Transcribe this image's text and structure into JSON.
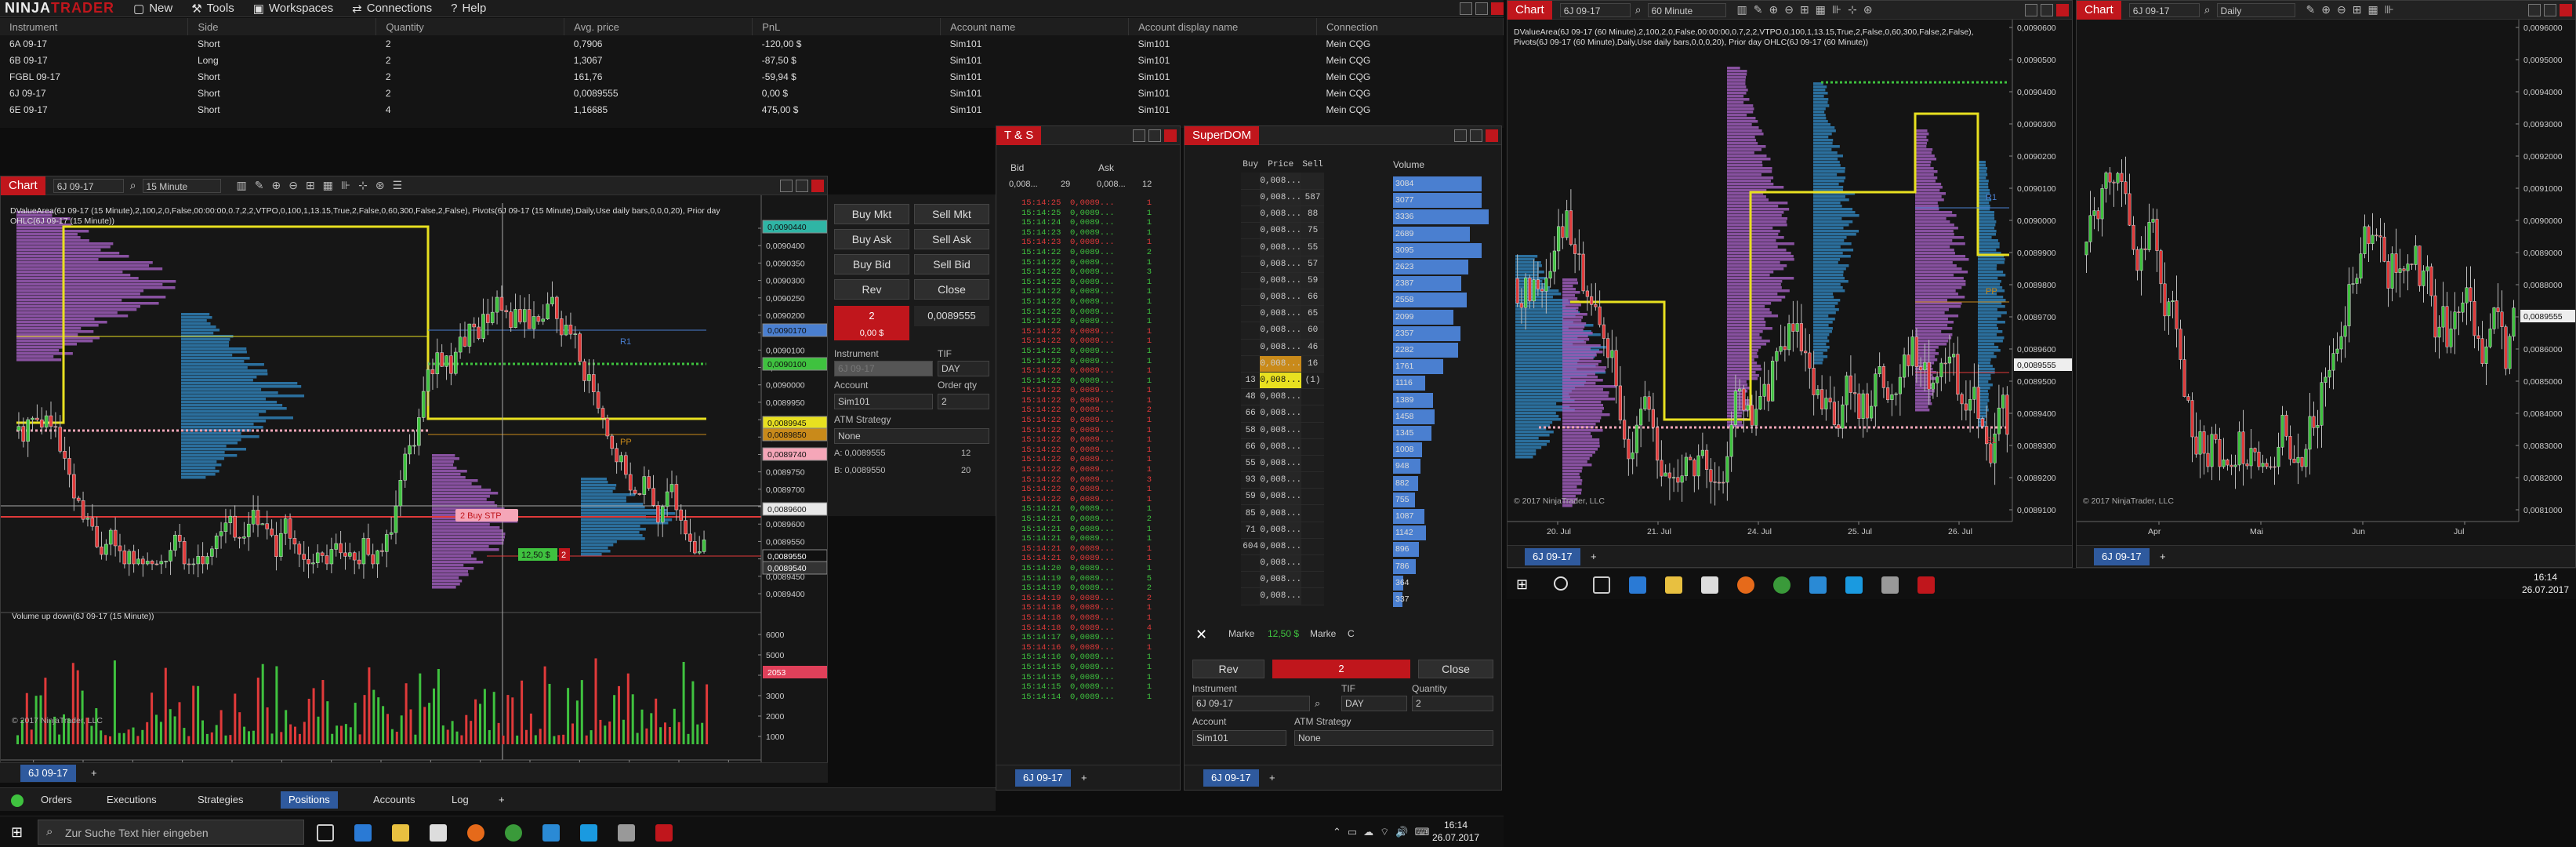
{
  "app": {
    "logo": "NINJATRADER",
    "menu": [
      "New",
      "Tools",
      "Workspaces",
      "Connections",
      "Help"
    ]
  },
  "positions": {
    "headers": [
      "Instrument",
      "Side",
      "Quantity",
      "Avg. price",
      "PnL",
      "Account name",
      "Account display name",
      "Connection"
    ],
    "rows": [
      [
        "6A 09-17",
        "Short",
        "2",
        "0,7906",
        "-120,00 $",
        "Sim101",
        "Sim101",
        "Mein CQG"
      ],
      [
        "6B 09-17",
        "Long",
        "2",
        "1,3067",
        "-87,50 $",
        "Sim101",
        "Sim101",
        "Mein CQG"
      ],
      [
        "FGBL 09-17",
        "Short",
        "2",
        "161,76",
        "-59,94 $",
        "Sim101",
        "Sim101",
        "Mein CQG"
      ],
      [
        "6J 09-17",
        "Short",
        "2",
        "0,0089555",
        "0,00 $",
        "Sim101",
        "Sim101",
        "Mein CQG"
      ],
      [
        "6E 09-17",
        "Short",
        "4",
        "1,16685",
        "475,00 $",
        "Sim101",
        "Sim101",
        "Mein CQG"
      ]
    ],
    "tabs": [
      "Orders",
      "Executions",
      "Strategies",
      "Positions",
      "Accounts",
      "Log"
    ],
    "active_tab": "Positions"
  },
  "chart1": {
    "title": "Chart",
    "instrument": "6J 09-17",
    "interval": "15 Minute",
    "indicator_text": "DValueArea(6J 09-17 (15 Minute),2,100,2,0,False,00:00:00,0.7,2,2,VTPO,0,100,1,13.15,True,2,False,0,60,300,False,2,False), Pivots(6J 09-17 (15 Minute),Daily,Use daily bars,0,0,0,20), Prior day OHLC(6J 09-17 (15 Minute))",
    "copyright": "© 2017 NinjaTrader, LLC",
    "volume_label": "Volume up down(6J 09-17 (15 Minute))",
    "price_ticks": [
      "0,0090450",
      "0,0090400",
      "0,0090350",
      "0,0090300",
      "0,0090250",
      "0,0090200",
      "0,0090150",
      "0,0090100",
      "0,0090050",
      "0,0090000",
      "0,0089950",
      "0,0089900",
      "0,0089850",
      "0,0089800",
      "0,0089750",
      "0,0089700",
      "0,0089650",
      "0,0089600",
      "0,0089550",
      "0,0089500",
      "0,0089450",
      "0,0089400"
    ],
    "price_flags": [
      {
        "text": "0,0090440",
        "color": "#2fb5a5"
      },
      {
        "text": "0,0090170",
        "color": "#4a7fd0"
      },
      {
        "text": "0,0090100",
        "color": "#3fc23f"
      },
      {
        "text": "0,0089945",
        "color": "#e8e020"
      },
      {
        "text": "0,0089850",
        "color": "#c98a1a"
      },
      {
        "text": "0,0089740",
        "color": "#f5a6b8"
      },
      {
        "text": "0,0089600",
        "color": "#e8e8e8"
      },
      {
        "text": "0,0089550",
        "color": "#111111"
      },
      {
        "text": "0,0089540",
        "color": "#333333"
      }
    ],
    "volume_ticks": [
      "6000",
      "5000",
      "4000",
      "3000",
      "2000",
      "1000"
    ],
    "volume_flag": "2053",
    "time_ticks": [
      "19:00",
      "25. Jul",
      "03:15",
      "06:00",
      "09:00",
      "11:45",
      "14:45",
      "17:45",
      "26. Jul",
      "03:15",
      "06:00",
      "09:00",
      "12:00",
      "14:45",
      "17:45"
    ],
    "order_label": "2  Buy STP",
    "position_label": "12,50 $",
    "position_qty": "2",
    "pivot_labels": [
      "R1",
      "PP"
    ],
    "tab": "6J 09-17"
  },
  "chart_trader": {
    "buttons": [
      "Buy Mkt",
      "Sell Mkt",
      "Buy Ask",
      "Sell Ask",
      "Buy Bid",
      "Sell Bid",
      "Rev",
      "Close"
    ],
    "position_qty": "2",
    "position_price": "0,0089555",
    "position_pnl": "0,00 $",
    "instrument_label": "Instrument",
    "tif_label": "TIF",
    "tif": "DAY",
    "instrument_value": "6J 09-17",
    "account_label": "Account",
    "account": "Sim101",
    "order_qty_label": "Order qty",
    "order_qty": "2",
    "atm_label": "ATM Strategy",
    "atm": "None",
    "ask": "A: 0,0089555",
    "ask_size": "12",
    "bid": "B: 0,0089550",
    "bid_size": "20"
  },
  "ts": {
    "title": "T & S",
    "headers": [
      "Bid",
      "Ask"
    ],
    "top": {
      "bid": "0,008...",
      "bid_size": "29",
      "ask": "0,008...",
      "ask_size": "12"
    },
    "rows": [
      [
        "15:14:25",
        "0,0089...",
        "1",
        "s"
      ],
      [
        "15:14:25",
        "0,0089...",
        "1",
        "b"
      ],
      [
        "15:14:24",
        "0,0089...",
        "1",
        "b"
      ],
      [
        "15:14:23",
        "0,0089...",
        "1",
        "b"
      ],
      [
        "15:14:23",
        "0,0089...",
        "1",
        "s"
      ],
      [
        "15:14:22",
        "0,0089...",
        "2",
        "b"
      ],
      [
        "15:14:22",
        "0,0089...",
        "1",
        "b"
      ],
      [
        "15:14:22",
        "0,0089...",
        "3",
        "b"
      ],
      [
        "15:14:22",
        "0,0089...",
        "1",
        "b"
      ],
      [
        "15:14:22",
        "0,0089...",
        "1",
        "b"
      ],
      [
        "15:14:22",
        "0,0089...",
        "1",
        "b"
      ],
      [
        "15:14:22",
        "0,0089...",
        "1",
        "b"
      ],
      [
        "15:14:22",
        "0,0089...",
        "1",
        "b"
      ],
      [
        "15:14:22",
        "0,0089...",
        "1",
        "s"
      ],
      [
        "15:14:22",
        "0,0089...",
        "1",
        "s"
      ],
      [
        "15:14:22",
        "0,0089...",
        "1",
        "b"
      ],
      [
        "15:14:22",
        "0,0089...",
        "1",
        "b"
      ],
      [
        "15:14:22",
        "0,0089...",
        "1",
        "s"
      ],
      [
        "15:14:22",
        "0,0089...",
        "1",
        "b"
      ],
      [
        "15:14:22",
        "0,0089...",
        "1",
        "s"
      ],
      [
        "15:14:22",
        "0,0089...",
        "1",
        "s"
      ],
      [
        "15:14:22",
        "0,0089...",
        "2",
        "s"
      ],
      [
        "15:14:22",
        "0,0089...",
        "1",
        "s"
      ],
      [
        "15:14:22",
        "0,0089...",
        "1",
        "s"
      ],
      [
        "15:14:22",
        "0,0089...",
        "1",
        "s"
      ],
      [
        "15:14:22",
        "0,0089...",
        "1",
        "s"
      ],
      [
        "15:14:22",
        "0,0089...",
        "1",
        "s"
      ],
      [
        "15:14:22",
        "0,0089...",
        "1",
        "s"
      ],
      [
        "15:14:22",
        "0,0089...",
        "3",
        "s"
      ],
      [
        "15:14:22",
        "0,0089...",
        "1",
        "s"
      ],
      [
        "15:14:22",
        "0,0089...",
        "1",
        "s"
      ],
      [
        "15:14:21",
        "0,0089...",
        "1",
        "b"
      ],
      [
        "15:14:21",
        "0,0089...",
        "2",
        "b"
      ],
      [
        "15:14:21",
        "0,0089...",
        "1",
        "b"
      ],
      [
        "15:14:21",
        "0,0089...",
        "1",
        "b"
      ],
      [
        "15:14:21",
        "0,0089...",
        "1",
        "s"
      ],
      [
        "15:14:21",
        "0,0089...",
        "1",
        "s"
      ],
      [
        "15:14:20",
        "0,0089...",
        "1",
        "b"
      ],
      [
        "15:14:19",
        "0,0089...",
        "5",
        "b"
      ],
      [
        "15:14:19",
        "0,0089...",
        "2",
        "b"
      ],
      [
        "15:14:19",
        "0,0089...",
        "2",
        "s"
      ],
      [
        "15:14:18",
        "0,0089...",
        "1",
        "s"
      ],
      [
        "15:14:18",
        "0,0089...",
        "1",
        "s"
      ],
      [
        "15:14:18",
        "0,0089...",
        "4",
        "s"
      ],
      [
        "15:14:17",
        "0,0089...",
        "1",
        "b"
      ],
      [
        "15:14:16",
        "0,0089...",
        "1",
        "s"
      ],
      [
        "15:14:16",
        "0,0089...",
        "1",
        "b"
      ],
      [
        "15:14:15",
        "0,0089...",
        "1",
        "b"
      ],
      [
        "15:14:15",
        "0,0089...",
        "1",
        "b"
      ],
      [
        "15:14:15",
        "0,0089...",
        "1",
        "b"
      ],
      [
        "15:14:14",
        "0,0089...",
        "1",
        "b"
      ]
    ],
    "tab": "6J 09-17"
  },
  "dom": {
    "title": "SuperDOM",
    "headers": [
      "Buy",
      "Price",
      "Sell",
      "Volume"
    ],
    "rows": [
      [
        "",
        "0,008...",
        "",
        "3084"
      ],
      [
        "",
        "0,008...",
        "587",
        "3077"
      ],
      [
        "",
        "0,008...",
        "88",
        "3336"
      ],
      [
        "",
        "0,008...",
        "75",
        "2689"
      ],
      [
        "",
        "0,008...",
        "55",
        "3095"
      ],
      [
        "",
        "0,008...",
        "57",
        "2623"
      ],
      [
        "",
        "0,008...",
        "59",
        "2387"
      ],
      [
        "",
        "0,008...",
        "66",
        "2558"
      ],
      [
        "",
        "0,008...",
        "65",
        "2099"
      ],
      [
        "",
        "0,008...",
        "60",
        "2357"
      ],
      [
        "",
        "0,008...",
        "46",
        "2282"
      ],
      [
        "",
        "0,008...",
        "16",
        "1761"
      ],
      [
        "13",
        "0,008...",
        "(1)",
        "1116"
      ],
      [
        "48",
        "0,008...",
        "",
        "1389"
      ],
      [
        "66",
        "0,008...",
        "",
        "1458"
      ],
      [
        "58",
        "0,008...",
        "",
        "1345"
      ],
      [
        "66",
        "0,008...",
        "",
        "1008"
      ],
      [
        "55",
        "0,008...",
        "",
        "948"
      ],
      [
        "93",
        "0,008...",
        "",
        "882"
      ],
      [
        "59",
        "0,008...",
        "",
        "755"
      ],
      [
        "85",
        "0,008...",
        "",
        "1087"
      ],
      [
        "71",
        "0,008...",
        "",
        "1142"
      ],
      [
        "604",
        "0,008...",
        "",
        "896"
      ],
      [
        "",
        "0,008...",
        "",
        "786"
      ],
      [
        "",
        "0,008...",
        "",
        "364"
      ],
      [
        "",
        "0,008...",
        "",
        "337"
      ]
    ],
    "bottom": {
      "left": "Marke",
      "pnl": "12,50 $",
      "right": "Marke",
      "c": "C"
    },
    "rev": "Rev",
    "qty": "2",
    "close": "Close",
    "instrument_label": "Instrument",
    "instrument": "6J 09-17",
    "tif_label": "TIF",
    "tif": "DAY",
    "quantity_label": "Quantity",
    "quantity": "2",
    "account_label": "Account",
    "account": "Sim101",
    "atm_label": "ATM Strategy",
    "atm": "None",
    "tab": "6J 09-17"
  },
  "chart2": {
    "title": "Chart",
    "instrument": "6J 09-17",
    "interval": "60 Minute",
    "indicator_text": "DValueArea(6J 09-17 (60 Minute),2,100,2,0,False,00:00:00,0.7,2,2,VTPO,0,100,1,13.15,True,2,False,0,60,300,False,2,False), Pivots(6J 09-17 (60 Minute),Daily,Use daily bars,0,0,0,20), Prior day OHLC(6J 09-17 (60 Minute))",
    "copyright": "© 2017 NinjaTrader, LLC",
    "price_ticks": [
      "0,0090600",
      "0,0090500",
      "0,0090400",
      "0,0090300",
      "0,0090200",
      "0,0090100",
      "0,0090000",
      "0,0089900",
      "0,0089800",
      "0,0089700",
      "0,0089600",
      "0,0089500",
      "0,0089400",
      "0,0089300",
      "0,0089200",
      "0,0089100"
    ],
    "price_flag": "0,0089555",
    "time_ticks": [
      "20. Jul",
      "21. Jul",
      "24. Jul",
      "25. Jul",
      "26. Jul"
    ],
    "pivot_labels": [
      "R1",
      "PP",
      "S1"
    ],
    "tab": "6J 09-17"
  },
  "chart3": {
    "title": "Chart",
    "instrument": "6J 09-17",
    "interval": "Daily",
    "copyright": "© 2017 NinjaTrader, LLC",
    "price_ticks": [
      "0,0096000",
      "0,0095000",
      "0,0094000",
      "0,0093000",
      "0,0092000",
      "0,0091000",
      "0,0090000",
      "0,0089000",
      "0,0088000",
      "0,0087000",
      "0,0086000",
      "0,0085000",
      "0,0084000",
      "0,0083000",
      "0,0082000",
      "0,0081000"
    ],
    "price_flag": "0,0089555",
    "time_ticks": [
      "Apr",
      "Mai",
      "Jun",
      "Jul"
    ],
    "tab": "6J 09-17"
  },
  "taskbar": {
    "search_placeholder": "Zur Suche Text hier eingeben",
    "time": "16:14",
    "date": "26.07.2017"
  }
}
